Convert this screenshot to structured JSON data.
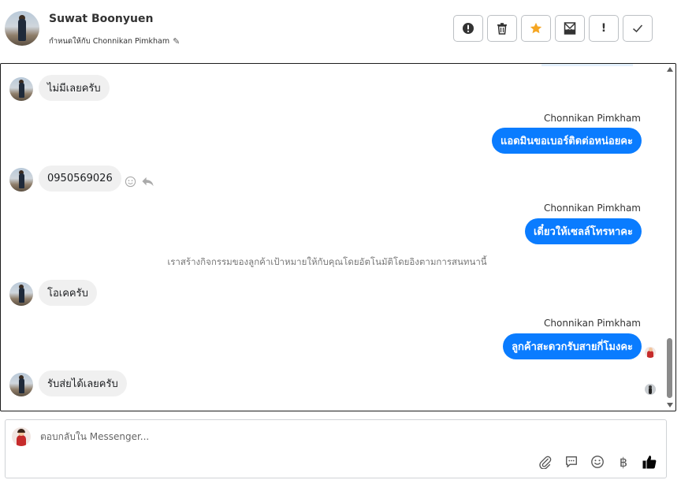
{
  "header": {
    "contact_name": "Suwat Boonyuen",
    "assigned_label": "กำหนดให้กับ Chonnikan Pimkham",
    "actions": [
      {
        "name": "report-icon"
      },
      {
        "name": "trash-icon"
      },
      {
        "name": "star-icon",
        "color": "#f5a623"
      },
      {
        "name": "mark-unread-icon"
      },
      {
        "name": "follow-up-icon",
        "label": "!"
      },
      {
        "name": "done-icon"
      }
    ]
  },
  "messages": {
    "m1": {
      "text": "ไม่มีเลยครับ"
    },
    "m2": {
      "sender": "Chonnikan Pimkham",
      "text": "แอดมินขอเบอร์ติดต่อหน่อยคะ"
    },
    "m3": {
      "text": "0950569026"
    },
    "m4": {
      "sender": "Chonnikan Pimkham",
      "text": "เดี๋ยวให้เซลล์โทรหาคะ"
    },
    "system": "เราสร้างกิจกรรมของลูกค้าเป้าหมายให้กับคุณโดยอัตโนมัติโดยอิงตามการสนทนานี้",
    "m5": {
      "text": "โอเคครับ"
    },
    "m6": {
      "sender": "Chonnikan Pimkham",
      "text": "ลูกค้าสะดวกรับสายกี่โมงคะ"
    },
    "m7": {
      "text": "รับส่ยได้เลยครับ"
    }
  },
  "composer": {
    "placeholder": "ตอบกลับใน Messenger...",
    "tools": [
      "attach-icon",
      "saved-reply-icon",
      "emoji-icon",
      "currency-icon",
      "like-icon"
    ],
    "accent": "#050505"
  },
  "colors": {
    "outgoing_bubble": "#0a7cff",
    "incoming_bubble": "#f0f0f0"
  }
}
